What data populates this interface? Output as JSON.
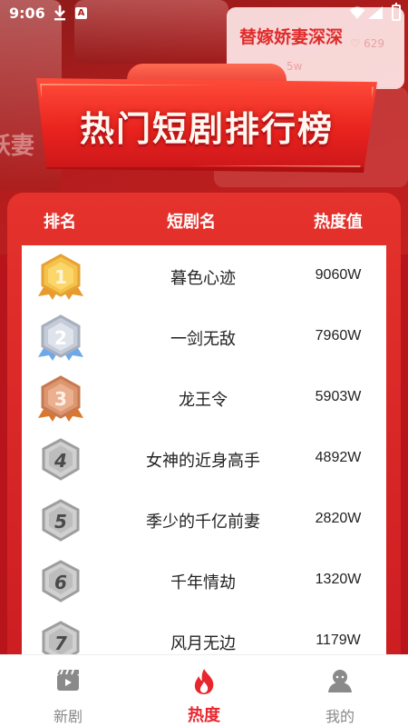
{
  "status_bar": {
    "time": "9:06"
  },
  "banner": {
    "title": "热门短剧排行榜"
  },
  "background_cards": {
    "left_ghost": "妖妻",
    "right_title": "替嫁娇妻深深",
    "right_meta": "5w",
    "right_likes": "629"
  },
  "table_header": {
    "rank": "排名",
    "name": "短剧名",
    "heat": "热度值"
  },
  "rankings": [
    {
      "rank": "1",
      "name": "暮色心迹",
      "heat": "9060W"
    },
    {
      "rank": "2",
      "name": "一剑无敌",
      "heat": "7960W"
    },
    {
      "rank": "3",
      "name": "龙王令",
      "heat": "5903W"
    },
    {
      "rank": "4",
      "name": "女神的近身高手",
      "heat": "4892W"
    },
    {
      "rank": "5",
      "name": "季少的千亿前妻",
      "heat": "2820W"
    },
    {
      "rank": "6",
      "name": "千年情劫",
      "heat": "1320W"
    },
    {
      "rank": "7",
      "name": "风月无边",
      "heat": "1179W"
    }
  ],
  "nav": {
    "items": [
      {
        "label": "新剧",
        "icon": "clapperboard-icon",
        "active": false
      },
      {
        "label": "热度",
        "icon": "flame-icon",
        "active": true
      },
      {
        "label": "我的",
        "icon": "user-icon",
        "active": false
      }
    ]
  },
  "colors": {
    "primary_red": "#e8262d",
    "gold": "#f2b33d",
    "silver": "#b9c1cf",
    "bronze": "#d98c62",
    "gray_badge": "#9a9a9a"
  }
}
